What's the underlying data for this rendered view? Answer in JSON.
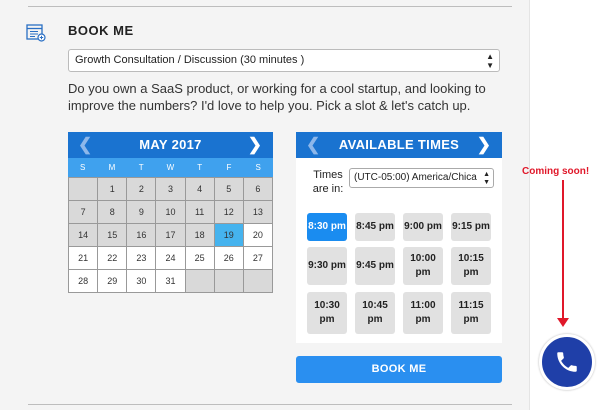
{
  "header": {
    "title": "BOOK ME",
    "icon": "calendar-list-icon"
  },
  "service_select": {
    "value": "Growth Consultation / Discussion (30 minutes )"
  },
  "description": "Do you own a SaaS product, or working for a cool startup, and looking to improve the numbers? I'd love to help you. Pick a slot & let's catch up.",
  "calendar": {
    "month": "MAY 2017",
    "prev": "❮",
    "next": "❯",
    "weekdays": [
      "S",
      "M",
      "T",
      "W",
      "T",
      "F",
      "S"
    ],
    "selected_day": "19",
    "days": [
      {
        "d": "",
        "s": "empty"
      },
      {
        "d": "1",
        "s": "past"
      },
      {
        "d": "2",
        "s": "past"
      },
      {
        "d": "3",
        "s": "past"
      },
      {
        "d": "4",
        "s": "past"
      },
      {
        "d": "5",
        "s": "past"
      },
      {
        "d": "6",
        "s": "past"
      },
      {
        "d": "7",
        "s": "past"
      },
      {
        "d": "8",
        "s": "past"
      },
      {
        "d": "9",
        "s": "past"
      },
      {
        "d": "10",
        "s": "past"
      },
      {
        "d": "11",
        "s": "past"
      },
      {
        "d": "12",
        "s": "past"
      },
      {
        "d": "13",
        "s": "past"
      },
      {
        "d": "14",
        "s": "past"
      },
      {
        "d": "15",
        "s": "past"
      },
      {
        "d": "16",
        "s": "past"
      },
      {
        "d": "17",
        "s": "past"
      },
      {
        "d": "18",
        "s": "past"
      },
      {
        "d": "19",
        "s": "today"
      },
      {
        "d": "20",
        "s": "avail"
      },
      {
        "d": "21",
        "s": "avail"
      },
      {
        "d": "22",
        "s": "avail"
      },
      {
        "d": "23",
        "s": "avail"
      },
      {
        "d": "24",
        "s": "avail"
      },
      {
        "d": "25",
        "s": "avail"
      },
      {
        "d": "26",
        "s": "avail"
      },
      {
        "d": "27",
        "s": "avail"
      },
      {
        "d": "28",
        "s": "avail"
      },
      {
        "d": "29",
        "s": "avail"
      },
      {
        "d": "30",
        "s": "avail"
      },
      {
        "d": "31",
        "s": "avail"
      },
      {
        "d": "",
        "s": "empty"
      },
      {
        "d": "",
        "s": "empty"
      },
      {
        "d": "",
        "s": "empty"
      }
    ]
  },
  "times": {
    "title": "AVAILABLE TIMES",
    "prev": "❮",
    "next": "❯",
    "tz_label": "Times are in:",
    "tz_value": "(UTC-05:00) America/Chica",
    "slots": [
      {
        "label": "8:30 pm",
        "selected": true
      },
      {
        "label": "8:45 pm",
        "selected": false
      },
      {
        "label": "9:00 pm",
        "selected": false
      },
      {
        "label": "9:15 pm",
        "selected": false
      },
      {
        "label": "9:30 pm",
        "selected": false
      },
      {
        "label": "9:45 pm",
        "selected": false
      },
      {
        "label": "10:00 pm",
        "selected": false
      },
      {
        "label": "10:15 pm",
        "selected": false
      },
      {
        "label": "10:30 pm",
        "selected": false
      },
      {
        "label": "10:45 pm",
        "selected": false
      },
      {
        "label": "11:00 pm",
        "selected": false
      },
      {
        "label": "11:15 pm",
        "selected": false
      }
    ]
  },
  "book_button": "BOOK ME",
  "coming_soon": "Coming soon!",
  "colors": {
    "primary": "#1a73d0",
    "accent": "#3fa1ee",
    "today": "#45b3ee",
    "phone": "#1f3fa8",
    "annotation": "#e0182a"
  },
  "phone_icon": "phone-icon"
}
